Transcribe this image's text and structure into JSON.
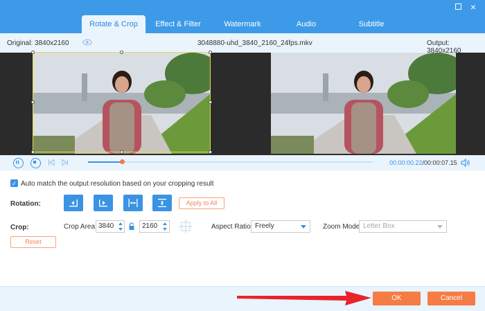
{
  "tabs": [
    {
      "label": "Rotate & Crop"
    },
    {
      "label": "Effect & Filter"
    },
    {
      "label": "Watermark"
    },
    {
      "label": "Audio"
    },
    {
      "label": "Subtitle"
    }
  ],
  "window": {
    "maximize_icon": "maximize-icon",
    "close_icon": "close-icon",
    "close_glyph": "×"
  },
  "info": {
    "original": "Original: 3840x2160",
    "filename": "3048880-uhd_3840_2160_24fps.mkv",
    "output": "Output: 3840x2160"
  },
  "player": {
    "current_time": "00:00:00.22",
    "total_time": "/00:00:07.15",
    "progress": 0.12
  },
  "auto_match": {
    "checked": true,
    "check_glyph": "✓",
    "label": "Auto match the output resolution based on your cropping result"
  },
  "rotation": {
    "label": "Rotation:",
    "buttons": [
      "rotate-left-icon",
      "rotate-right-icon",
      "flip-horizontal-icon",
      "flip-vertical-icon"
    ],
    "apply_label": "Apply to All"
  },
  "crop": {
    "label": "Crop:",
    "area_label": "Crop Area:",
    "width": "3840",
    "height": "2160",
    "aspect_label": "Aspect Ratio:",
    "aspect_value": "Freely",
    "zoom_label": "Zoom Mode:",
    "zoom_value": "Letter Box",
    "reset_label": "Reset"
  },
  "footer": {
    "ok_label": "OK",
    "cancel_label": "Cancel"
  },
  "colors": {
    "accent": "#3d9ae8",
    "orange": "#f57c45",
    "arrow": "#e8232a",
    "crop_frame": "#e8d84a"
  }
}
